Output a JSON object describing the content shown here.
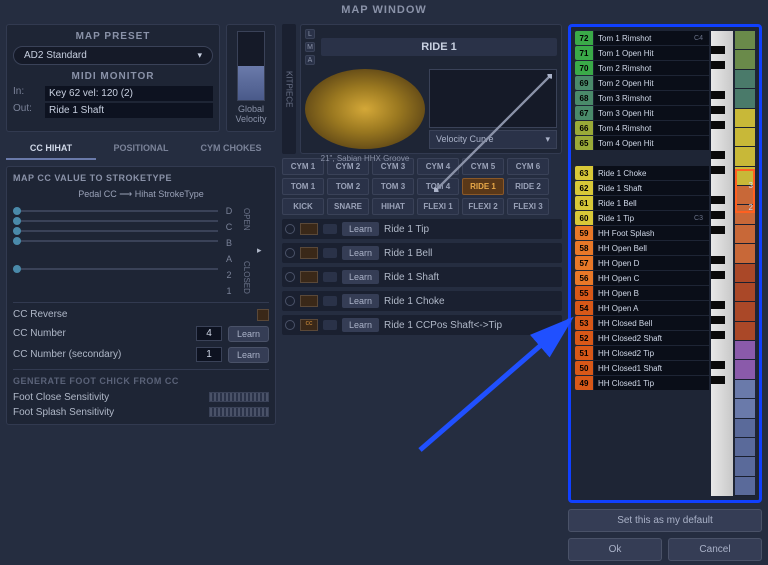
{
  "window_title": "MAP WINDOW",
  "preset": {
    "title": "MAP PRESET",
    "value": "AD2 Standard"
  },
  "global_velocity_label": "Global Velocity",
  "midi_monitor": {
    "title": "MIDI MONITOR",
    "in_label": "In:",
    "in_value": "Key 62 vel: 120 (2)",
    "out_label": "Out:",
    "out_value": "Ride 1 Shaft"
  },
  "tabs": {
    "cc_hihat": "CC HIHAT",
    "positional": "POSITIONAL",
    "cym_chokes": "CYM CHOKES"
  },
  "cc_map": {
    "header": "MAP CC VALUE TO STROKETYPE",
    "sub_left": "Pedal CC",
    "sub_arrow": "⟶",
    "sub_right": "Hihat StrokeType",
    "letters": [
      "D",
      "C",
      "B",
      "A",
      "2",
      "1"
    ],
    "open_label": "OPEN",
    "closed_label": "CLOSED",
    "reverse_label": "CC Reverse",
    "number_label": "CC Number",
    "number_value": "4",
    "secondary_label": "CC Number (secondary)",
    "secondary_value": "1",
    "learn": "Learn"
  },
  "foot_chick": {
    "header": "GENERATE FOOT CHICK FROM CC",
    "close_label": "Foot Close Sensitivity",
    "splash_label": "Foot Splash Sensitivity"
  },
  "kitpiece": {
    "side": "KITPIECE",
    "dots": [
      "L",
      "M",
      "A"
    ],
    "title": "RIDE 1",
    "caption": "21\", Sabian HHX Groove",
    "vcurve_label": "Velocity Curve"
  },
  "kit_buttons": [
    "CYM 1",
    "CYM 2",
    "CYM 3",
    "CYM 4",
    "CYM 5",
    "CYM 6",
    "TOM 1",
    "TOM 2",
    "TOM 3",
    "TOM 4",
    "RIDE 1",
    "RIDE 2",
    "KICK",
    "SNARE",
    "HIHAT",
    "FLEXI 1",
    "FLEXI 2",
    "FLEXI 3"
  ],
  "kit_active": "RIDE 1",
  "learn_rows": [
    {
      "name": "Ride 1 Tip",
      "cc": ""
    },
    {
      "name": "Ride 1 Bell",
      "cc": ""
    },
    {
      "name": "Ride 1 Shaft",
      "cc": ""
    },
    {
      "name": "Ride 1 Choke",
      "cc": ""
    },
    {
      "name": "Ride 1 CCPos Shaft<->Tip",
      "cc": "cc"
    }
  ],
  "learn_btn": "Learn",
  "keymap": [
    {
      "n": "72",
      "name": "Tom 1 Rimshot",
      "c": "c-green",
      "note": "C4"
    },
    {
      "n": "71",
      "name": "Tom 1 Open Hit",
      "c": "c-green"
    },
    {
      "n": "70",
      "name": "Tom 2 Rimshot",
      "c": "c-green"
    },
    {
      "n": "69",
      "name": "Tom 2 Open Hit",
      "c": "c-teal"
    },
    {
      "n": "68",
      "name": "Tom 3 Rimshot",
      "c": "c-teal"
    },
    {
      "n": "67",
      "name": "Tom 3 Open Hit",
      "c": "c-teal"
    },
    {
      "n": "66",
      "name": "Tom 4 Rimshot",
      "c": "c-ygreen"
    },
    {
      "n": "65",
      "name": "Tom 4 Open Hit",
      "c": "c-ygreen"
    },
    {
      "n": "",
      "name": "",
      "c": ""
    },
    {
      "n": "63",
      "name": "Ride 1 Choke",
      "c": "c-yellow"
    },
    {
      "n": "62",
      "name": "Ride 1 Shaft",
      "c": "c-yellow",
      "hl": true
    },
    {
      "n": "61",
      "name": "Ride 1 Bell",
      "c": "c-yellow"
    },
    {
      "n": "60",
      "name": "Ride 1 Tip",
      "c": "c-yellow",
      "note": "C3"
    },
    {
      "n": "59",
      "name": "HH Foot Splash",
      "c": "c-orange"
    },
    {
      "n": "58",
      "name": "HH Open Bell",
      "c": "c-orange"
    },
    {
      "n": "57",
      "name": "HH Open D",
      "c": "c-orange"
    },
    {
      "n": "56",
      "name": "HH Open C",
      "c": "c-orange"
    },
    {
      "n": "55",
      "name": "HH Open B",
      "c": "c-dorange"
    },
    {
      "n": "54",
      "name": "HH Open A",
      "c": "c-dorange"
    },
    {
      "n": "53",
      "name": "HH Closed Bell",
      "c": "c-dorange"
    },
    {
      "n": "52",
      "name": "HH Closed2 Shaft",
      "c": "c-dorange"
    },
    {
      "n": "51",
      "name": "HH Closed2 Tip",
      "c": "c-dorange"
    },
    {
      "n": "50",
      "name": "HH Closed1 Shaft",
      "c": "c-dorange"
    },
    {
      "n": "49",
      "name": "HH Closed1 Tip",
      "c": "c-dorange"
    }
  ],
  "meter_labels": [
    "3",
    "2"
  ],
  "set_default": "Set this as my default",
  "ok": "Ok",
  "cancel": "Cancel"
}
